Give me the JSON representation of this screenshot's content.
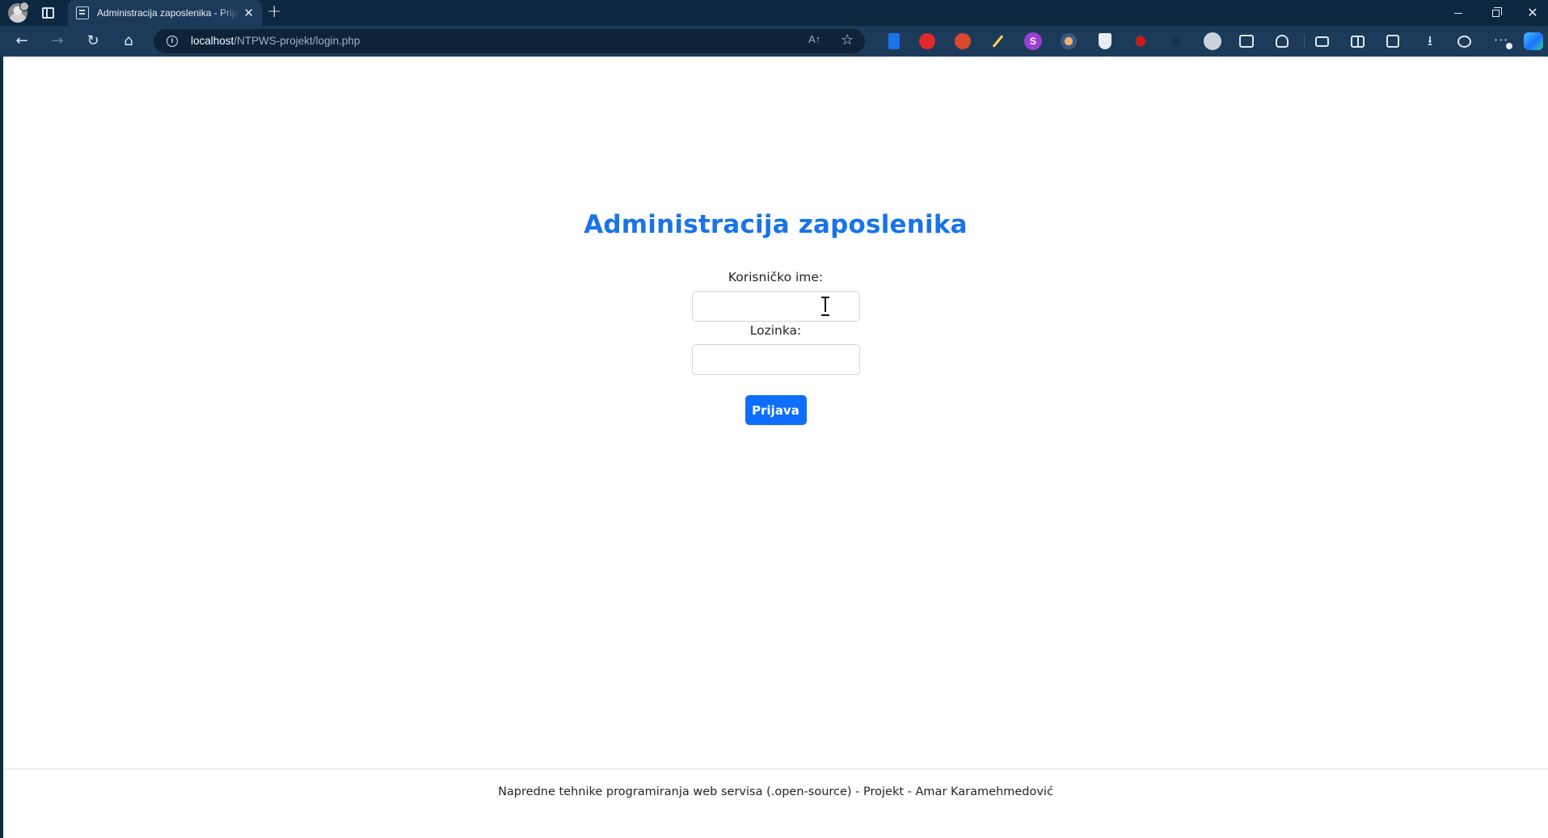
{
  "browser": {
    "tab_title": "Administracija zaposlenika - Prijava",
    "url_host": "localhost",
    "url_path": "/NTPWS-projekt/login.php",
    "read_aloud_label": "A↑",
    "accent_color": "#1a73e8"
  },
  "page": {
    "title": "Administracija zaposlenika",
    "form": {
      "username_label": "Korisničko ime:",
      "username_value": "",
      "password_label": "Lozinka:",
      "password_value": "",
      "submit_label": "Prijava",
      "submit_color": "#0d6efd"
    },
    "footer": "Napredne tehnike programiranja web servisa (.open-source) - Projekt - Amar Karamehmedović"
  },
  "icons": [
    "profile-avatar",
    "tab-actions-icon",
    "page-favicon",
    "close-tab-icon",
    "new-tab-icon",
    "back-icon",
    "forward-icon",
    "reload-icon",
    "home-icon",
    "site-info-icon",
    "read-aloud-icon",
    "favorite-star-icon",
    "extensions-icon",
    "downloads-icon",
    "settings-more-icon",
    "copilot-icon"
  ]
}
